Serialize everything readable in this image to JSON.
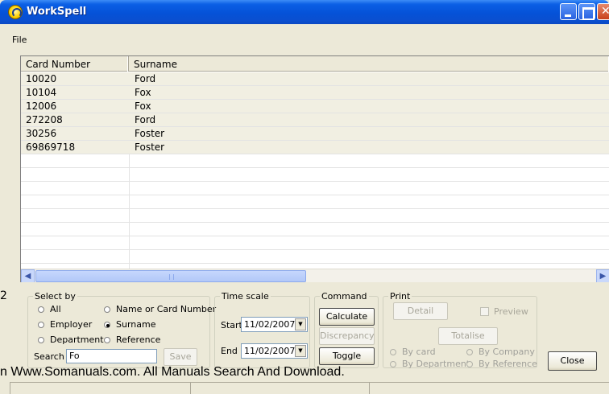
{
  "window": {
    "title": "WorkSpell"
  },
  "menu": {
    "file": "File"
  },
  "list": {
    "headers": {
      "card_number": "Card Number",
      "surname": "Surname"
    },
    "rows": [
      {
        "card": "10020",
        "surname": "Ford"
      },
      {
        "card": "10104",
        "surname": "Fox"
      },
      {
        "card": "12006",
        "surname": "Fox"
      },
      {
        "card": "272208",
        "surname": "Ford"
      },
      {
        "card": "30256",
        "surname": "Foster"
      },
      {
        "card": "69869718",
        "surname": "Foster"
      }
    ]
  },
  "select_by": {
    "legend": "Select by",
    "all": "All",
    "employer": "Employer",
    "department": "Department",
    "name_or_card": "Name or Card Number",
    "surname": "Surname",
    "reference": "Reference",
    "selected": "Surname",
    "search_label": "Search",
    "search_value": "Fo",
    "save": "Save"
  },
  "time_scale": {
    "legend": "Time scale",
    "start_label": "Start",
    "start_date": "11/02/2007",
    "end_label": "End",
    "end_date": "11/02/2007"
  },
  "command": {
    "legend": "Command",
    "calculate": "Calculate",
    "discrepancy": "Discrepancy",
    "toggle": "Toggle"
  },
  "print": {
    "legend": "Print",
    "detail": "Detail",
    "preview": "Preview",
    "totalise": "Totalise",
    "by_card": "By card",
    "by_company": "By Company",
    "by_department": "By Department",
    "by_reference": "By Reference"
  },
  "close": "Close",
  "side_number": "2",
  "footer": "n Www.Somanuals.com. All Manuals Search And Download."
}
